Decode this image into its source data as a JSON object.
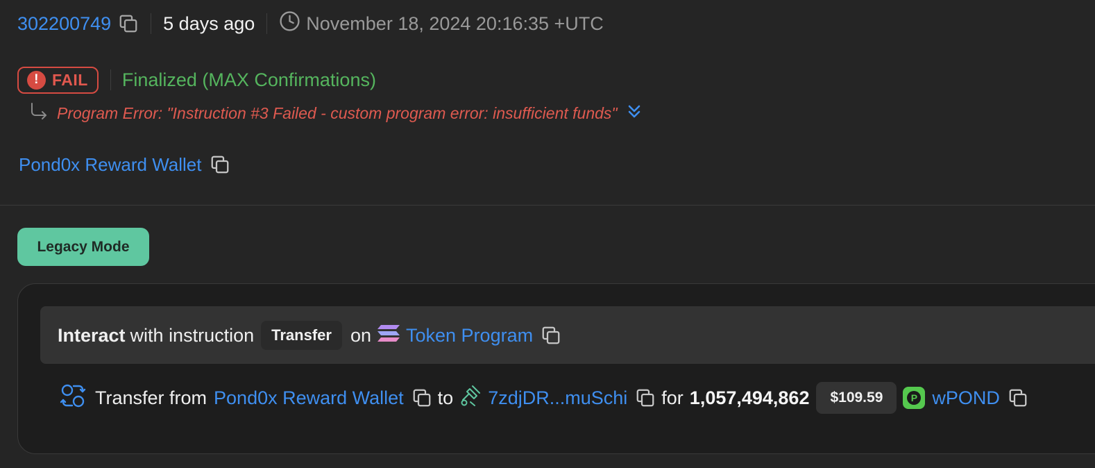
{
  "header": {
    "slot": "302200749",
    "time_ago": "5 days ago",
    "timestamp": "November 18, 2024 20:16:35 +UTC"
  },
  "status": {
    "badge": "FAIL",
    "badge_icon": "exclamation-icon",
    "confirmation": "Finalized (MAX Confirmations)",
    "error": "Program Error: \"Instruction #3 Failed - custom program error: insufficient funds\""
  },
  "signer": {
    "label": "Pond0x Reward Wallet"
  },
  "mode_button": "Legacy Mode",
  "instruction": {
    "verb": "Interact",
    "text": "with instruction",
    "name": "Transfer",
    "on": "on",
    "program": "Token Program"
  },
  "transfer": {
    "prefix": "Transfer from",
    "from": "Pond0x Reward Wallet",
    "to_word": "to",
    "to": "7zdjDR...muSchi",
    "for_word": "for",
    "amount": "1,057,494,862",
    "usd_value": "$109.59",
    "token": "wPOND",
    "token_logo_letter": "P"
  },
  "colors": {
    "link": "#3f8ff0",
    "fail": "#d64b42",
    "finalized": "#55b55e",
    "accent_button": "#5fc7a0"
  }
}
